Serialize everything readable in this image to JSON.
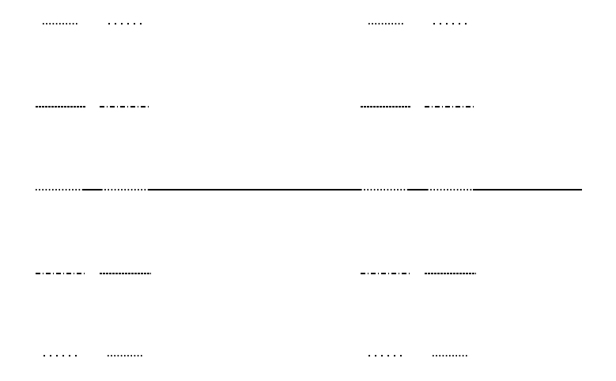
{
  "ink_color": "#000000",
  "background_color": "#ffffff",
  "groups": [
    {
      "name": "left",
      "rows": [
        {
          "name": "row-1-top",
          "segments": [
            {
              "pattern": "dotted"
            },
            {
              "pattern": "sparse-dash-dot"
            }
          ]
        },
        {
          "name": "row-2",
          "segments": [
            {
              "pattern": "fine-dashed"
            },
            {
              "pattern": "dash-dot"
            }
          ]
        },
        {
          "name": "row-3-center",
          "segments": [
            {
              "pattern": "dotted"
            },
            {
              "pattern": "solid"
            },
            {
              "pattern": "dotted"
            },
            {
              "pattern": "solid"
            }
          ]
        },
        {
          "name": "row-4",
          "segments": [
            {
              "pattern": "dash-dot"
            },
            {
              "pattern": "fine-dashed"
            }
          ]
        },
        {
          "name": "row-5-bottom",
          "segments": [
            {
              "pattern": "sparse-dash-dot"
            },
            {
              "pattern": "dotted"
            }
          ]
        }
      ]
    },
    {
      "name": "right",
      "rows": [
        {
          "name": "row-1-top",
          "segments": [
            {
              "pattern": "dotted"
            },
            {
              "pattern": "sparse-dash-dot"
            }
          ]
        },
        {
          "name": "row-2",
          "segments": [
            {
              "pattern": "fine-dashed"
            },
            {
              "pattern": "dash-dot"
            }
          ]
        },
        {
          "name": "row-3-center",
          "segments": [
            {
              "pattern": "dotted"
            },
            {
              "pattern": "solid"
            },
            {
              "pattern": "dotted"
            },
            {
              "pattern": "solid"
            }
          ]
        },
        {
          "name": "row-4",
          "segments": [
            {
              "pattern": "dash-dot"
            },
            {
              "pattern": "fine-dashed"
            }
          ]
        },
        {
          "name": "row-5-bottom",
          "segments": [
            {
              "pattern": "sparse-dash-dot"
            },
            {
              "pattern": "dotted"
            }
          ]
        }
      ]
    }
  ]
}
